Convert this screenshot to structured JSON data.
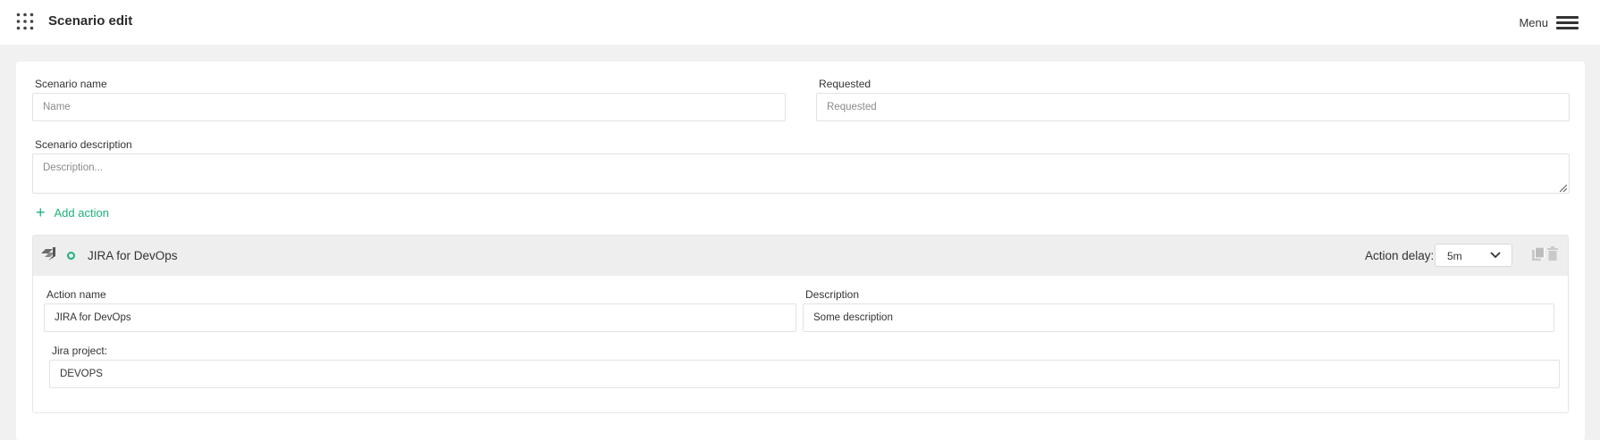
{
  "header": {
    "title": "Scenario edit",
    "menu_label": "Menu"
  },
  "form": {
    "scenario_name_label": "Scenario name",
    "scenario_name_placeholder": "Name",
    "scenario_name_value": "",
    "requested_label": "Requested",
    "requested_placeholder": "Requested",
    "requested_value": "",
    "description_label": "Scenario description",
    "description_placeholder": "Description...",
    "description_value": "",
    "add_action_label": "Add action"
  },
  "action": {
    "title": "JIRA for DevOps",
    "delay_label": "Action delay:",
    "delay_value": "5m",
    "action_name_label": "Action name",
    "action_name_value": "JIRA for DevOps",
    "description_label": "Description",
    "description_value": "Some description",
    "jira_project_label": "Jira project:",
    "jira_project_value": "DEVOPS"
  },
  "colors": {
    "accent": "#1cb379",
    "page_bg": "#f1f1f1",
    "header_bg": "#eeeeee"
  },
  "icons": [
    "apps-grid-icon",
    "hamburger-icon",
    "plus-icon",
    "jira-icon",
    "status-circle-icon",
    "chevron-down-icon",
    "copy-icon",
    "trash-icon"
  ]
}
